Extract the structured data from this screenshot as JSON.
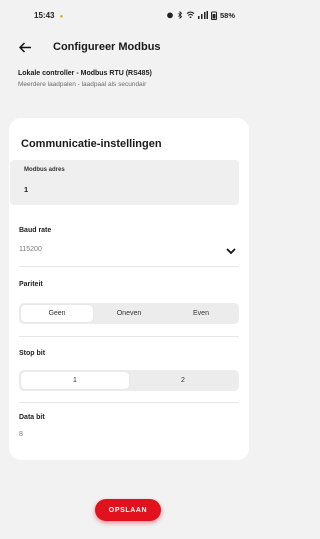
{
  "status_bar": {
    "time": "15:43",
    "icons_text": "58%"
  },
  "header": {
    "title": "Configureer Modbus"
  },
  "subtitle": {
    "line1": "Lokale controller - Modbus RTU (RS485)",
    "line2": "Meerdere laadpalen - laadpaal als secundair"
  },
  "section": {
    "title": "Communicatie-instellingen"
  },
  "modbus_address": {
    "label": "Modbus adres",
    "value": "1"
  },
  "baud_rate": {
    "label": "Baud rate",
    "value": "115200"
  },
  "parity": {
    "label": "Pariteit",
    "options": [
      "Geen",
      "Oneven",
      "Even"
    ],
    "selected": "Geen"
  },
  "stop_bit": {
    "label": "Stop bit",
    "options": [
      "1",
      "2"
    ],
    "selected": "1"
  },
  "data_bit": {
    "label": "Data bit",
    "value": "8"
  },
  "save_button": {
    "label": "OPSLAAN"
  },
  "colors": {
    "accent": "#e2111e",
    "background": "#f2f2f2",
    "card": "#ffffff"
  }
}
